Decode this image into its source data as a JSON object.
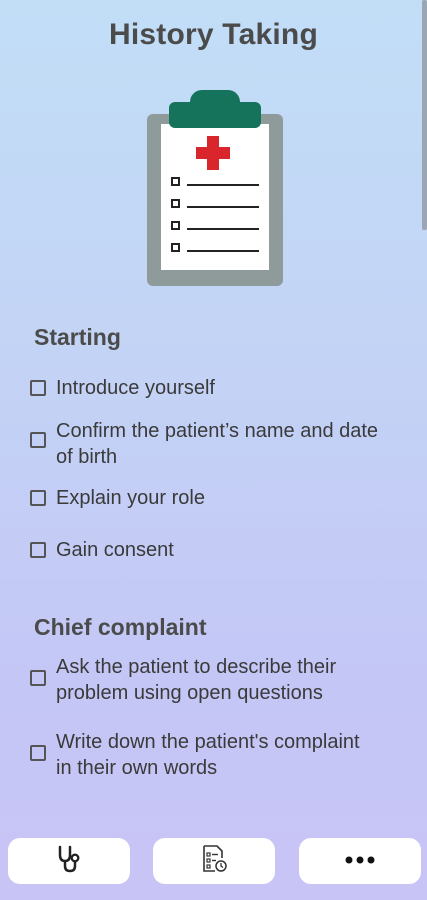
{
  "header": {
    "title": "History Taking"
  },
  "sections": [
    {
      "title": "Starting",
      "items": [
        {
          "label": "Introduce yourself",
          "checked": false
        },
        {
          "label": "Confirm the patient’s name and date of birth",
          "checked": false
        },
        {
          "label": "Explain your role",
          "checked": false
        },
        {
          "label": "Gain consent",
          "checked": false
        }
      ]
    },
    {
      "title": "Chief complaint",
      "items": [
        {
          "label": "Ask the patient to describe their problem using open questions",
          "checked": false
        },
        {
          "label": "Write down the patient's complaint in their own words",
          "checked": false
        }
      ]
    }
  ],
  "bottom_nav": [
    {
      "name": "stethoscope-icon"
    },
    {
      "name": "checklist-icon"
    },
    {
      "name": "more-icon"
    }
  ],
  "colors": {
    "accent_green": "#14735a",
    "cross_red": "#d8262c",
    "clipboard_board": "#8f9a9a"
  }
}
